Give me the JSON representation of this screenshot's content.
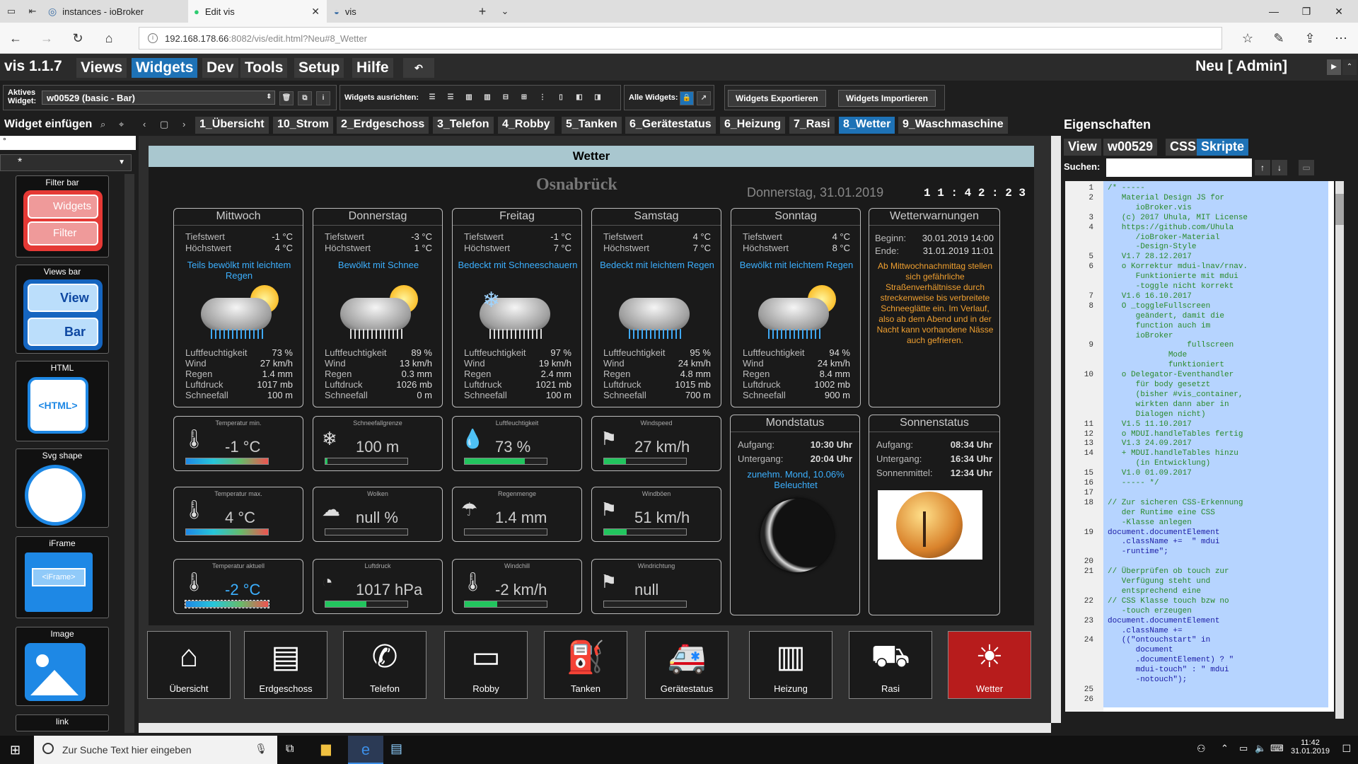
{
  "browser": {
    "tabs": [
      {
        "title": "instances - ioBroker"
      },
      {
        "title": "Edit vis"
      },
      {
        "title": "vis"
      }
    ],
    "url_host": "192.168.178.66",
    "url_rest": ":8082/vis/edit.html?Neu#8_Wetter"
  },
  "menu": {
    "logo": "vis 1.1.7",
    "items": [
      "Views",
      "Widgets",
      "Dev",
      "Tools",
      "Setup",
      "Hilfe"
    ],
    "right": "Neu [ Admin]"
  },
  "toolbar": {
    "active_label1": "Aktives",
    "active_label2": "Widget:",
    "active_value": "w00529 (basic - Bar)",
    "align_label": "Widgets ausrichten:",
    "all_label": "Alle Widgets:",
    "export": "Widgets Exportieren",
    "import": "Widgets Importieren"
  },
  "viewrow": {
    "insert_label": "Widget einfügen",
    "tabs": [
      "1_Übersicht",
      "10_Strom",
      "2_Erdgeschoss",
      "3_Telefon",
      "4_Robby",
      "5_Tanken",
      "6_Gerätestatus",
      "6_Heizung",
      "7_Rasi",
      "8_Wetter",
      "9_Waschmaschine"
    ]
  },
  "palette": {
    "filter": "*",
    "widgets": [
      {
        "title": "Filter bar",
        "b1": "Widgets",
        "b2": "Filter"
      },
      {
        "title": "Views bar",
        "b1": "View",
        "b2": "Bar"
      },
      {
        "title": "HTML",
        "b1": "<HTML>"
      },
      {
        "title": "Svg shape"
      },
      {
        "title": "iFrame",
        "b1": "<iFrame>"
      },
      {
        "title": "Image"
      },
      {
        "title": "link"
      }
    ]
  },
  "weather": {
    "title": "Wetter",
    "city": "Osnabrück",
    "date": "Donnerstag, 31.01.2019",
    "time": "1 1 : 4 2 : 2 3",
    "days": [
      {
        "name": "Mittwoch",
        "tief": "-1 °C",
        "hoch": "4 °C",
        "desc": "Teils bewölkt mit leichtem Regen",
        "feucht": "73 %",
        "wind": "27 km/h",
        "regen": "1.4 mm",
        "druck": "1017 mb",
        "schnee": "100 m"
      },
      {
        "name": "Donnerstag",
        "tief": "-3 °C",
        "hoch": "1 °C",
        "desc": "Bewölkt mit Schnee",
        "feucht": "89 %",
        "wind": "13 km/h",
        "regen": "0.3 mm",
        "druck": "1026 mb",
        "schnee": "0 m"
      },
      {
        "name": "Freitag",
        "tief": "-1 °C",
        "hoch": "7 °C",
        "desc": "Bedeckt mit Schneeschauern",
        "feucht": "97 %",
        "wind": "19 km/h",
        "regen": "2.4 mm",
        "druck": "1021 mb",
        "schnee": "100 m"
      },
      {
        "name": "Samstag",
        "tief": "4 °C",
        "hoch": "7 °C",
        "desc": "Bedeckt mit leichtem Regen",
        "feucht": "95 %",
        "wind": "24 km/h",
        "regen": "4.8 mm",
        "druck": "1015 mb",
        "schnee": "700 m"
      },
      {
        "name": "Sonntag",
        "tief": "4 °C",
        "hoch": "8 °C",
        "desc": "Bewölkt mit leichtem Regen",
        "feucht": "94 %",
        "wind": "24 km/h",
        "regen": "8.4 mm",
        "druck": "1002 mb",
        "schnee": "900 m"
      }
    ],
    "labels": {
      "tief": "Tiefstwert",
      "hoch": "Höchstwert",
      "feucht": "Luftfeuchtigkeit",
      "wind": "Wind",
      "regen": "Regen",
      "druck": "Luftdruck",
      "schnee": "Schneefall"
    },
    "warn": {
      "title": "Wetterwarnungen",
      "begin_l": "Beginn:",
      "begin_v": "30.01.2019 14:00",
      "end_l": "Ende:",
      "end_v": "31.01.2019 11:01",
      "text": "Ab Mittwochnachmittag stellen sich gefährliche Straßenverhältnisse durch streckenweise bis verbreitete Schneeglätte ein. Im Verlauf, also ab dem Abend und in der Nacht kann vorhandene Nässe auch gefrieren."
    },
    "tiles": [
      {
        "title": "Temperatur min.",
        "value": "-1 °C",
        "fill": 1.0,
        "type": "temp"
      },
      {
        "title": "Schneefallgrenze",
        "value": "100 m",
        "fill": 0.03,
        "type": "green"
      },
      {
        "title": "Luftfeuchtigkeit",
        "value": "73 %",
        "fill": 0.73,
        "type": "green"
      },
      {
        "title": "Windspeed",
        "value": "27 km/h",
        "fill": 0.27,
        "type": "green"
      },
      {
        "title": "Temperatur max.",
        "value": "4 °C",
        "fill": 1.0,
        "type": "temp"
      },
      {
        "title": "Wolken",
        "value": "null %",
        "fill": 0,
        "type": "green"
      },
      {
        "title": "Regenmenge",
        "value": "1.4 mm",
        "fill": 0,
        "type": "green"
      },
      {
        "title": "Windböen",
        "value": "51 km/h",
        "fill": 0.28,
        "type": "green"
      },
      {
        "title": "Temperatur aktuell",
        "value": "-2 °C",
        "fill": 1.0,
        "type": "temp",
        "hl": true
      },
      {
        "title": "Luftdruck",
        "value": "1017 hPa",
        "fill": 0.5,
        "type": "green"
      },
      {
        "title": "Windchill",
        "value": "-2 km/h",
        "fill": 0.4,
        "type": "green"
      },
      {
        "title": "Windrichtung",
        "value": "null",
        "fill": 0,
        "type": "green"
      }
    ],
    "moon": {
      "title": "Mondstatus",
      "auf_l": "Aufgang:",
      "auf_v": "10:30 Uhr",
      "unter_l": "Untergang:",
      "unter_v": "20:04 Uhr",
      "phase": "zunehm. Mond, 10.06% Beleuchtet"
    },
    "sun": {
      "title": "Sonnenstatus",
      "auf_l": "Aufgang:",
      "auf_v": "08:34 Uhr",
      "unter_l": "Untergang:",
      "unter_v": "16:34 Uhr",
      "mittel_l": "Sonnenmittel:",
      "mittel_v": "12:34 Uhr"
    },
    "nav": [
      "Übersicht",
      "Erdgeschoss",
      "Telefon",
      "Robby",
      "Tanken",
      "Gerätestatus",
      "Heizung",
      "Rasi",
      "Wetter"
    ]
  },
  "props": {
    "title": "Eigenschaften",
    "tabs": [
      "View",
      "w00529",
      "CSS",
      "Skripte"
    ],
    "search_label": "Suchen:",
    "code": [
      [
        "1",
        "/* -----"
      ],
      [
        "2",
        "   Material Design JS for"
      ],
      [
        "",
        "      ioBroker.vis"
      ],
      [
        "3",
        "   (c) 2017 Uhula, MIT License"
      ],
      [
        "4",
        "   https://github.com/Uhula"
      ],
      [
        "",
        "      /ioBroker-Material"
      ],
      [
        "",
        "      -Design-Style"
      ],
      [
        "5",
        "   V1.7 28.12.2017"
      ],
      [
        "6",
        "   o Korrektur mdui-lnav/rnav."
      ],
      [
        "",
        "      Funktionierte mit mdui"
      ],
      [
        "",
        "      -toggle nicht korrekt"
      ],
      [
        "7",
        "   V1.6 16.10.2017"
      ],
      [
        "8",
        "   O _toggleFullscreen"
      ],
      [
        "",
        "      geändert, damit die"
      ],
      [
        "",
        "      function auch im"
      ],
      [
        "",
        "      ioBroker"
      ],
      [
        "9",
        "                 fullscreen"
      ],
      [
        "",
        "             Mode"
      ],
      [
        "",
        "             funktioniert"
      ],
      [
        "10",
        "   o Delegator-Eventhandler"
      ],
      [
        "",
        "      für body gesetzt"
      ],
      [
        "",
        "      (bisher #vis_container,"
      ],
      [
        "",
        "      wirkten dann aber in"
      ],
      [
        "",
        "      Dialogen nicht)"
      ],
      [
        "11",
        "   V1.5 11.10.2017"
      ],
      [
        "12",
        "   o MDUI.handleTables fertig"
      ],
      [
        "13",
        "   V1.3 24.09.2017"
      ],
      [
        "14",
        "   + MDUI.handleTables hinzu"
      ],
      [
        "",
        "      (in Entwicklung)"
      ],
      [
        "15",
        "   V1.0 01.09.2017"
      ],
      [
        "16",
        "   ----- */"
      ],
      [
        "17",
        ""
      ],
      [
        "18",
        "// Zur sicheren CSS-Erkennung"
      ],
      [
        "",
        "   der Runtime eine CSS"
      ],
      [
        "",
        "   -Klasse anlegen"
      ],
      [
        "19",
        "document.documentElement"
      ],
      [
        "",
        "   .className +=  \" mdui"
      ],
      [
        "",
        "   -runtime\";"
      ],
      [
        "20",
        ""
      ],
      [
        "21",
        "// Überprüfen ob touch zur"
      ],
      [
        "",
        "   Verfügung steht und"
      ],
      [
        "",
        "   entsprechend eine"
      ],
      [
        "22",
        "// CSS Klasse touch bzw no"
      ],
      [
        "",
        "   -touch erzeugen"
      ],
      [
        "23",
        "document.documentElement"
      ],
      [
        "",
        "   .className +="
      ],
      [
        "24",
        "   ((\"ontouchstart\" in"
      ],
      [
        "",
        "      document"
      ],
      [
        "",
        "      .documentElement) ? \""
      ],
      [
        "",
        "      mdui-touch\" : \" mdui"
      ],
      [
        "",
        "      -notouch\");"
      ],
      [
        "25",
        ""
      ],
      [
        "26",
        ""
      ]
    ]
  },
  "taskbar": {
    "search": "Zur Suche Text hier eingeben",
    "time": "11:42",
    "date": "31.01.2019"
  }
}
